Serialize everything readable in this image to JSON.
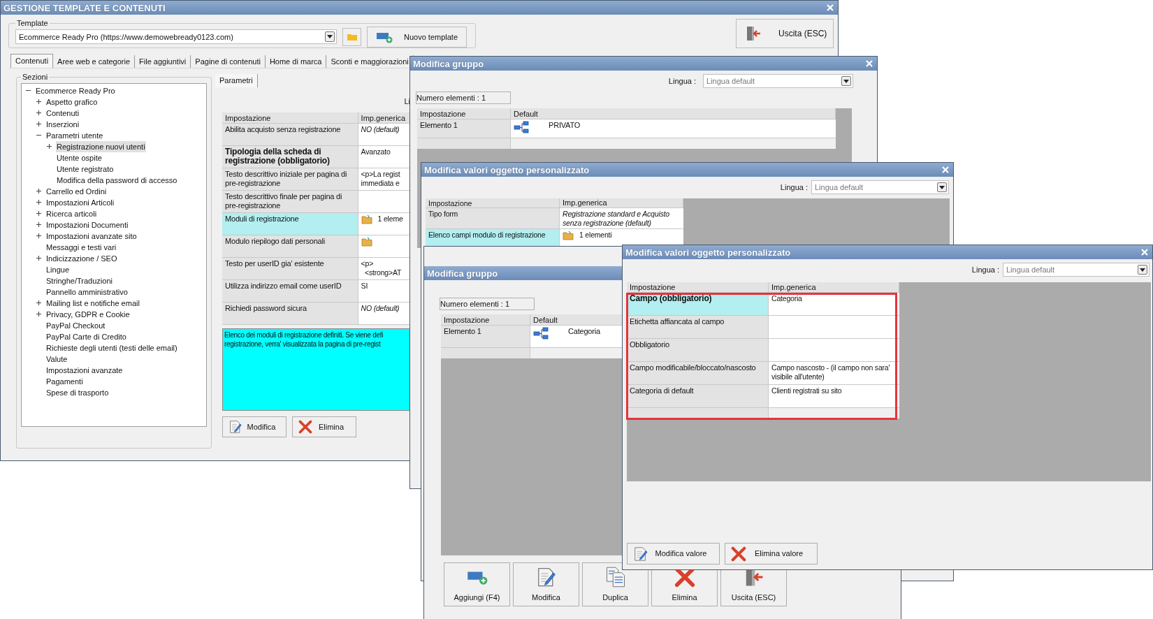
{
  "main_window": {
    "title": "GESTIONE TEMPLATE E CONTENUTI",
    "template_label": "Template",
    "template_value": "Ecommerce Ready Pro (https://www.demowebready0123.com)",
    "new_template_button": "Nuovo template",
    "exit_button": "Uscita (ESC)",
    "tabs": [
      {
        "label": "Contenuti",
        "selected": true
      },
      {
        "label": "Aree web e categorie",
        "selected": false
      },
      {
        "label": "File aggiuntivi",
        "selected": false
      },
      {
        "label": "Pagine di contenuti",
        "selected": false
      },
      {
        "label": "Home di marca",
        "selected": false
      },
      {
        "label": "Sconti e maggiorazioni",
        "selected": false
      }
    ],
    "sections_label": "Sezioni",
    "tree": [
      {
        "label": "Ecommerce Ready Pro",
        "kind": "branch",
        "expanded": true,
        "selected": false,
        "children": [
          {
            "label": "Aspetto grafico",
            "kind": "branch",
            "expanded": false,
            "selected": false
          },
          {
            "label": "Contenuti",
            "kind": "branch",
            "expanded": false,
            "selected": false
          },
          {
            "label": "Inserzioni",
            "kind": "branch",
            "expanded": false,
            "selected": false
          },
          {
            "label": "Parametri utente",
            "kind": "branch",
            "expanded": true,
            "selected": false,
            "children": [
              {
                "label": "Registrazione nuovi utenti",
                "kind": "branch",
                "expanded": false,
                "selected": true
              },
              {
                "label": "Utente ospite",
                "kind": "leaf",
                "selected": false
              },
              {
                "label": "Utente registrato",
                "kind": "leaf",
                "selected": false
              },
              {
                "label": "Modifica della password di accesso",
                "kind": "leaf",
                "selected": false
              }
            ]
          },
          {
            "label": "Carrello ed Ordini",
            "kind": "branch",
            "expanded": false,
            "selected": false
          },
          {
            "label": "Impostazioni Articoli",
            "kind": "branch",
            "expanded": false,
            "selected": false
          },
          {
            "label": "Ricerca articoli",
            "kind": "branch",
            "expanded": false,
            "selected": false
          },
          {
            "label": "Impostazioni Documenti",
            "kind": "branch",
            "expanded": false,
            "selected": false
          },
          {
            "label": "Impostazioni avanzate sito",
            "kind": "branch",
            "expanded": false,
            "selected": false
          },
          {
            "label": "Messaggi e testi vari",
            "kind": "leaf",
            "selected": false
          },
          {
            "label": "Indicizzazione / SEO",
            "kind": "branch",
            "expanded": false,
            "selected": false
          },
          {
            "label": "Lingue",
            "kind": "leaf",
            "selected": false
          },
          {
            "label": "Stringhe/Traduzioni",
            "kind": "leaf",
            "selected": false
          },
          {
            "label": "Pannello amministrativo",
            "kind": "leaf",
            "selected": false
          },
          {
            "label": "Mailing list e notifiche email",
            "kind": "branch",
            "expanded": false,
            "selected": false
          },
          {
            "label": "Privacy, GDPR e Cookie",
            "kind": "branch",
            "expanded": false,
            "selected": false
          },
          {
            "label": "PayPal Checkout",
            "kind": "leaf",
            "selected": false
          },
          {
            "label": "PayPal Carte di Credito",
            "kind": "leaf",
            "selected": false
          },
          {
            "label": "Richieste degli utenti (testi delle email)",
            "kind": "leaf",
            "selected": false
          },
          {
            "label": "Valute",
            "kind": "leaf",
            "selected": false
          },
          {
            "label": "Impostazioni avanzate",
            "kind": "leaf",
            "selected": false
          },
          {
            "label": "Pagamenti",
            "kind": "leaf",
            "selected": false
          },
          {
            "label": "Spese di trasporto",
            "kind": "leaf",
            "selected": false
          }
        ]
      }
    ],
    "params_tab": "Parametri",
    "language_label": "Li",
    "table": {
      "columns": [
        "Impostazione",
        "Imp.generica"
      ],
      "rows": [
        {
          "setting": "Abilita acquisto senza registrazione",
          "kind": "text",
          "value": "NO (default)",
          "required": false,
          "is_default": true,
          "selected": false
        },
        {
          "setting": "Tipologia della scheda di registrazione (obbligatorio)",
          "kind": "text",
          "value": "Avanzato",
          "required": true,
          "is_default": false,
          "selected": false
        },
        {
          "setting": "Testo descrittivo iniziale per pagina di pre-registrazione",
          "kind": "text",
          "value": "<p>La regist\nimmediata e",
          "required": false,
          "is_default": false,
          "selected": false
        },
        {
          "setting": "Testo descrittivo finale per pagina di pre-registrazione",
          "kind": "empty",
          "required": false,
          "selected": false
        },
        {
          "setting": "Moduli di registrazione",
          "kind": "folder",
          "value": "1 eleme",
          "required": false,
          "is_default": false,
          "selected": true
        },
        {
          "setting": "Modulo riepilogo dati personali",
          "kind": "folder",
          "required": false,
          "selected": false
        },
        {
          "setting": "Testo per userID gia' esistente",
          "kind": "text",
          "value": "<p>\n  <strong>AT",
          "required": false,
          "is_default": false,
          "selected": false
        },
        {
          "setting": "Utilizza indirizzo email come userID",
          "kind": "text",
          "value": "SI",
          "required": false,
          "is_default": false,
          "selected": false
        },
        {
          "setting": "Richiedi password sicura",
          "kind": "text",
          "value": "NO (default)",
          "required": false,
          "is_default": true,
          "selected": false
        }
      ]
    },
    "description_lines": [
      "Elenco dei moduli di registrazione definiti. Se viene defi",
      "registrazione, verra' visualizzata la pagina di pre-regist"
    ],
    "buttons": [
      {
        "label": "Modifica",
        "kind": "edit"
      },
      {
        "label": "Elimina",
        "kind": "delete"
      }
    ]
  },
  "group_dialog": {
    "title": "Modifica gruppo",
    "language_label": "Lingua :",
    "language_value": "Lingua default",
    "count_label": "Numero elementi : 1",
    "table": {
      "columns": [
        "Impostazione",
        "Default"
      ],
      "rows": [
        {
          "setting": "Elemento 1",
          "kind": "hierarchy",
          "value": "PRIVATO",
          "required": false,
          "is_default": false,
          "selected": false
        }
      ]
    }
  },
  "values_dialog": {
    "title": "Modifica valori oggetto personalizzato",
    "language_label": "Lingua :",
    "language_value": "Lingua default",
    "table": {
      "columns": [
        "Impostazione",
        "Imp.generica"
      ],
      "rows": [
        {
          "setting": "Tipo form",
          "kind": "text",
          "value": "Registrazione standard e Acquisto\nsenza registrazione (default)",
          "required": false,
          "is_default": true,
          "selected": false
        },
        {
          "setting": "Elenco campi modulo di registrazione",
          "kind": "folder",
          "value": "1 elementi",
          "required": false,
          "is_default": false,
          "selected": true
        }
      ]
    }
  },
  "group_dialog_2": {
    "title": "Modifica gruppo",
    "count_label": "Numero elementi : 1",
    "table": {
      "columns": [
        "Impostazione",
        "Default"
      ],
      "rows": [
        {
          "setting": "Elemento 1",
          "kind": "hierarchy",
          "value": "Categoria",
          "required": false,
          "is_default": false,
          "selected": false
        }
      ]
    },
    "buttons": [
      {
        "label": "Aggiungi (F4)",
        "kind": "add"
      },
      {
        "label": "Modifica",
        "kind": "edit"
      },
      {
        "label": "Duplica",
        "kind": "duplicate"
      },
      {
        "label": "Elimina",
        "kind": "delete"
      },
      {
        "label": "Uscita (ESC)",
        "kind": "exit"
      }
    ]
  },
  "values_dialog_2": {
    "title": "Modifica valori oggetto personalizzato",
    "language_label": "Lingua :",
    "language_value": "Lingua default",
    "highlighted": true,
    "table": {
      "columns": [
        "Impostazione",
        "Imp.generica"
      ],
      "rows": [
        {
          "setting": "Campo (obbligatorio)",
          "kind": "text",
          "value": "Categoria",
          "required": true,
          "is_default": false,
          "selected": true
        },
        {
          "setting": "Etichetta affiancata al campo",
          "kind": "empty",
          "required": false,
          "selected": false
        },
        {
          "setting": "Obbligatorio",
          "kind": "empty",
          "required": false,
          "selected": false
        },
        {
          "setting": "Campo modificabile/bloccato/nascosto",
          "kind": "text",
          "value": "Campo nascosto - (il campo non sara'\nvisibile all'utente)",
          "required": false,
          "is_default": false,
          "selected": false
        },
        {
          "setting": "Categoria di default",
          "kind": "text",
          "value": "Clienti registrati su sito",
          "required": false,
          "is_default": false,
          "selected": false
        }
      ]
    },
    "buttons": [
      {
        "label": "Modifica valore",
        "kind": "edit"
      },
      {
        "label": "Elimina valore",
        "kind": "delete"
      }
    ]
  }
}
